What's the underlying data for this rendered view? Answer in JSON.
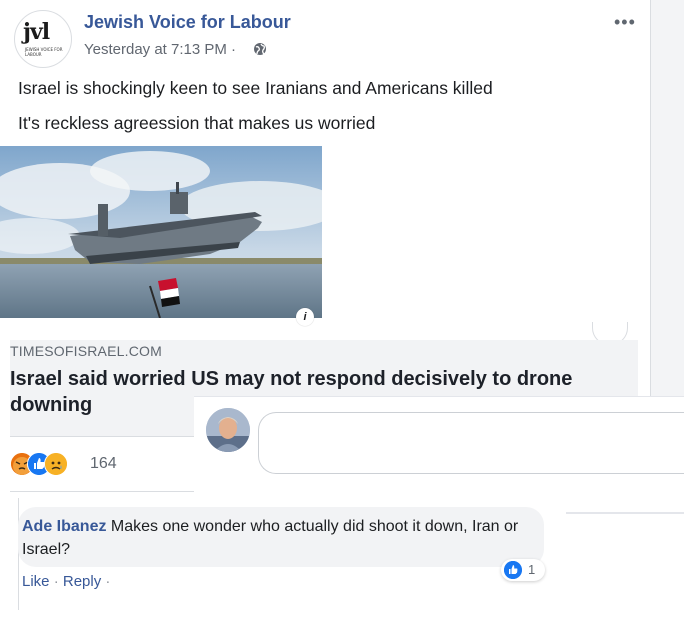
{
  "post": {
    "page_name": "Jewish Voice for Labour",
    "timestamp": "Yesterday at 7:13 PM · ",
    "audience_icon": "globe-icon",
    "avatar_logo": "jvl",
    "avatar_logo_sub": "JEWISH VOICE FOR LABOUR",
    "lines": [
      "Israel is shockingly keen to see Iranians and Americans killed",
      "It's reckless agreession that makes us worried"
    ]
  },
  "link_preview": {
    "domain": "TIMESOFISRAEL.COM",
    "title": "Israel said worried US may not respond decisively to drone downing",
    "info_icon_label": "i"
  },
  "reactions": {
    "icons": [
      "angry-icon",
      "like-icon",
      "sad-icon"
    ],
    "count": "164"
  },
  "comment": {
    "author": "Ade Ibanez",
    "text": " Makes one wonder who actually did shoot it down, Iran or Israel?",
    "like_count": "1",
    "actions": {
      "like": "Like",
      "reply": "Reply"
    }
  },
  "colors": {
    "link_blue": "#385898",
    "like_blue": "#1877f2",
    "angry": "#e9710f",
    "sad": "#f7b125"
  }
}
